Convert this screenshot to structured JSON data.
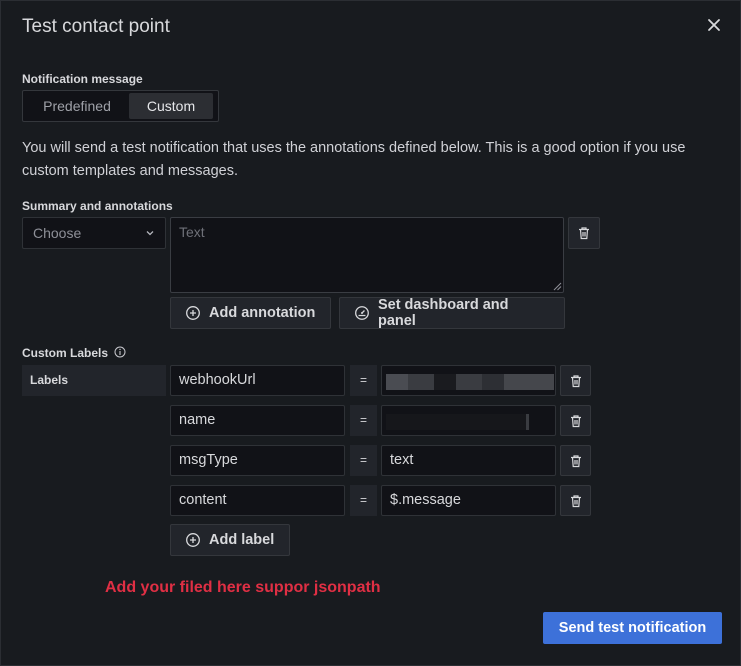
{
  "modal": {
    "title": "Test contact point"
  },
  "notification": {
    "label": "Notification message",
    "options": [
      "Predefined",
      "Custom"
    ],
    "selected": "Custom"
  },
  "description": "You will send a test notification that uses the annotations defined below. This is a good option if you use custom templates and messages.",
  "annotations": {
    "label": "Summary and annotations",
    "select_placeholder": "Choose",
    "text_placeholder": "Text",
    "add_annotation_label": "Add annotation",
    "set_dashboard_label": "Set dashboard and panel"
  },
  "custom_labels": {
    "label": "Custom Labels",
    "tag": "Labels",
    "rows": [
      {
        "key": "webhookUrl",
        "op": "=",
        "value": ""
      },
      {
        "key": "name",
        "op": "=",
        "value": ""
      },
      {
        "key": "msgType",
        "op": "=",
        "value": "text"
      },
      {
        "key": "content",
        "op": "=",
        "value": "$.message"
      }
    ],
    "add_label": "Add label"
  },
  "note": "Add your filed here suppor jsonpath",
  "send_button": "Send test notification",
  "colors": {
    "primary": "#3d71d9",
    "note": "#e02f44",
    "background": "#181b1f"
  },
  "icons": {
    "close": "close-icon",
    "trash": "trash-icon",
    "plus_circle": "plus-circle-icon",
    "dashboard": "dashboard-icon",
    "info": "info-circle-icon",
    "chevron": "chevron-down-icon"
  }
}
